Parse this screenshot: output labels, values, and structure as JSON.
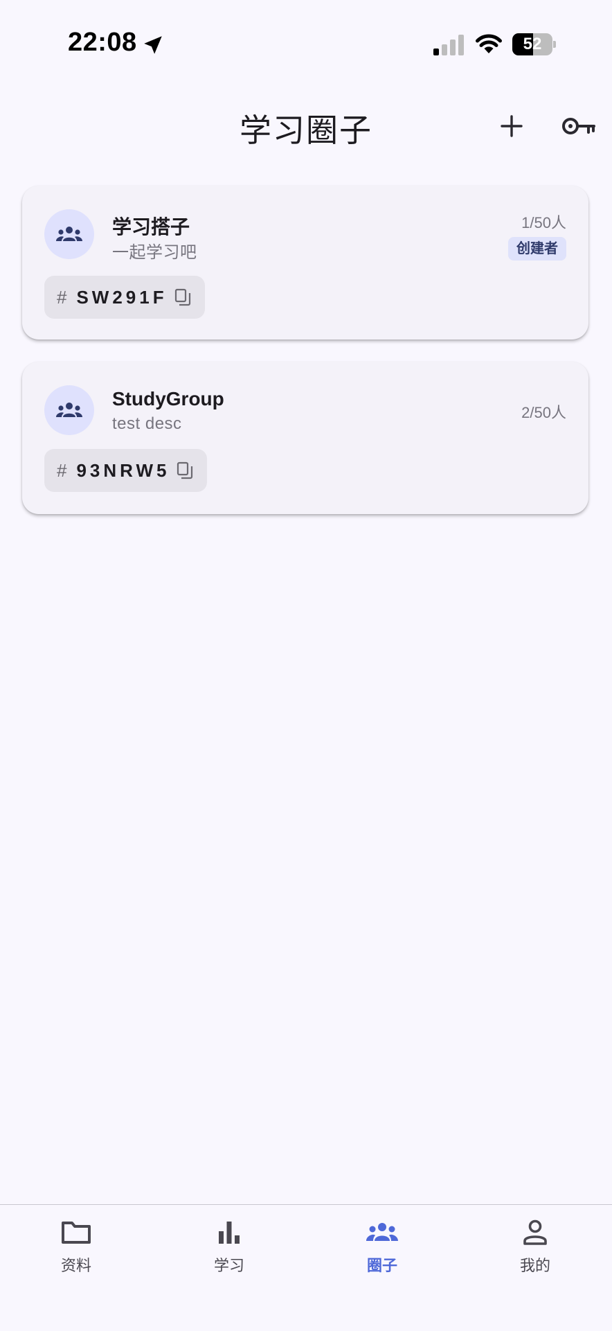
{
  "status_bar": {
    "time": "22:08",
    "battery_level": "52",
    "battery_fraction": 0.52,
    "icons": [
      "location-arrow-icon",
      "cellular-signal-icon",
      "wifi-icon",
      "battery-icon"
    ]
  },
  "header": {
    "title": "学习圈子",
    "actions": [
      "add-icon",
      "key-icon"
    ]
  },
  "groups": [
    {
      "name": "学习搭子",
      "description": "一起学习吧",
      "members": "1/50人",
      "role": "创建者",
      "code": "SW291F"
    },
    {
      "name": "StudyGroup",
      "description": "test desc",
      "members": "2/50人",
      "role": "",
      "code": "93NRW5"
    }
  ],
  "nav": {
    "items": [
      {
        "label": "资料",
        "icon": "folder-icon",
        "active": false
      },
      {
        "label": "学习",
        "icon": "bar-chart-icon",
        "active": false
      },
      {
        "label": "圈子",
        "icon": "groups-icon",
        "active": true
      },
      {
        "label": "我的",
        "icon": "person-icon",
        "active": false
      }
    ]
  },
  "colors": {
    "accent": "#4e68d8",
    "background": "#f9f7fe",
    "card": "#f4f2f9",
    "badge_bg": "#dfe2fb",
    "avatar_bg": "#dfe1fd"
  }
}
